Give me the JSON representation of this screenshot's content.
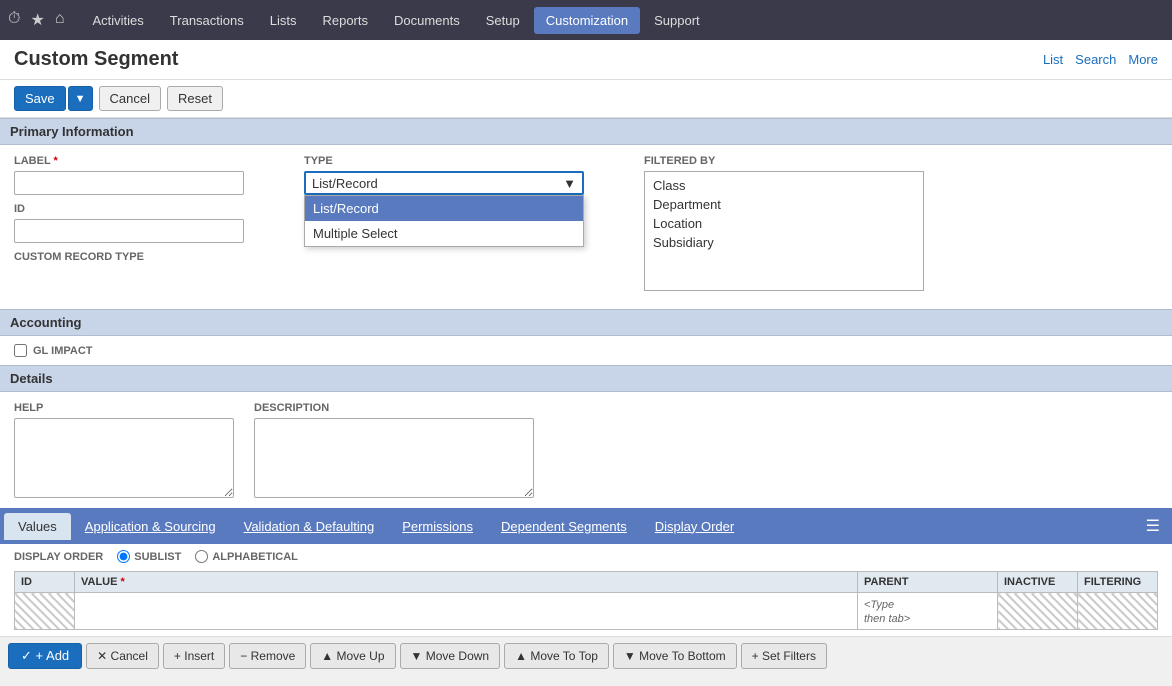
{
  "nav": {
    "icons": [
      {
        "name": "history-icon",
        "symbol": "⏱"
      },
      {
        "name": "star-icon",
        "symbol": "★"
      },
      {
        "name": "home-icon",
        "symbol": "⌂"
      }
    ],
    "items": [
      {
        "label": "Activities",
        "active": false
      },
      {
        "label": "Transactions",
        "active": false
      },
      {
        "label": "Lists",
        "active": false
      },
      {
        "label": "Reports",
        "active": false
      },
      {
        "label": "Documents",
        "active": false
      },
      {
        "label": "Setup",
        "active": false
      },
      {
        "label": "Customization",
        "active": true
      },
      {
        "label": "Support",
        "active": false
      }
    ]
  },
  "page": {
    "title": "Custom Segment",
    "actions": [
      "List",
      "Search",
      "More"
    ]
  },
  "toolbar": {
    "save_label": "Save",
    "save_dropdown_label": "▼",
    "cancel_label": "Cancel",
    "reset_label": "Reset"
  },
  "sections": {
    "primary": "Primary Information",
    "accounting": "Accounting",
    "details": "Details"
  },
  "primary_info": {
    "label_field": {
      "label": "LABEL",
      "required": true,
      "value": ""
    },
    "id_field": {
      "label": "ID",
      "required": false,
      "value": ""
    },
    "custom_record_type": {
      "label": "CUSTOM RECORD TYPE"
    },
    "type_field": {
      "label": "TYPE",
      "selected": "List/Record",
      "options": [
        "List/Record",
        "Multiple Select"
      ]
    },
    "filtered_by": {
      "label": "FILTERED BY",
      "items": [
        "Class",
        "Department",
        "Location",
        "Subsidiary"
      ]
    }
  },
  "accounting": {
    "gl_impact_label": "GL IMPACT"
  },
  "details": {
    "help_label": "HELP",
    "description_label": "DESCRIPTION"
  },
  "tabs": {
    "items": [
      {
        "label": "Values",
        "active": true
      },
      {
        "label": "Application & Sourcing",
        "active": false,
        "underline": true
      },
      {
        "label": "Validation & Defaulting",
        "active": false,
        "underline": true
      },
      {
        "label": "Permissions",
        "active": false,
        "underline": true
      },
      {
        "label": "Dependent Segments",
        "active": false,
        "underline": true
      },
      {
        "label": "Display Order",
        "active": false,
        "underline": true
      }
    ]
  },
  "values_section": {
    "display_order_label": "DISPLAY ORDER",
    "sublist_label": "SUBLIST",
    "alphabetical_label": "ALPHABETICAL",
    "table": {
      "columns": [
        {
          "key": "id",
          "label": "ID"
        },
        {
          "key": "value",
          "label": "VALUE",
          "required": true
        },
        {
          "key": "parent",
          "label": "PARENT"
        },
        {
          "key": "inactive",
          "label": "INACTIVE"
        },
        {
          "key": "filtering",
          "label": "FILTERING"
        }
      ],
      "rows": [
        {
          "id": "",
          "value": "",
          "parent": "<Type\nthen tab>",
          "inactive": "",
          "filtering": ""
        }
      ]
    }
  },
  "bottom_toolbar": {
    "add_label": "+ Add",
    "add_checkmark": "✓",
    "cancel_label": "✕ Cancel",
    "insert_label": "+ Insert",
    "remove_label": "− Remove",
    "move_up_label": "▲ Move Up",
    "move_down_label": "▼ Move Down",
    "move_to_top_label": "▲ Move To Top",
    "move_to_bottom_label": "▼ Move To Bottom",
    "set_filters_label": "+ Set Filters"
  }
}
